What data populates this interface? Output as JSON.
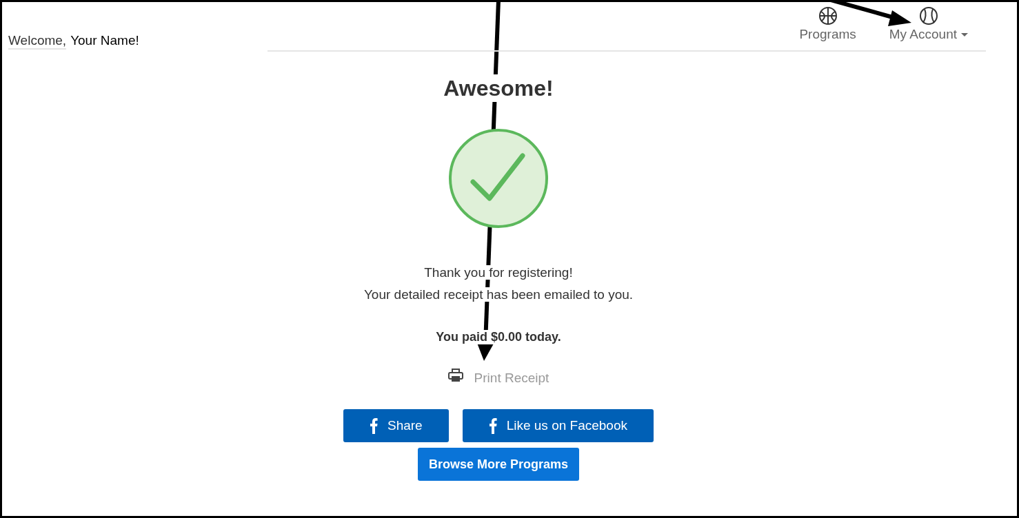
{
  "header": {
    "greeting": "Welcome,",
    "name": "Your Name!"
  },
  "nav": [
    {
      "label": "Programs",
      "kind": "basketball",
      "dropdown": false
    },
    {
      "label": "My Account",
      "kind": "account",
      "dropdown": true
    }
  ],
  "confirmation": {
    "heading": "Awesome!",
    "messages": [
      "Thank you for registering!",
      "Your detailed receipt has been emailed to you."
    ],
    "payment": "You paid $0.00 today.",
    "print_link": "Print Receipt"
  },
  "share_buttons": [
    {
      "label": "Share",
      "kind": "facebook"
    },
    {
      "label": "Like us on Facebook",
      "kind": "facebook"
    }
  ],
  "browse_button": "Browse More Programs"
}
